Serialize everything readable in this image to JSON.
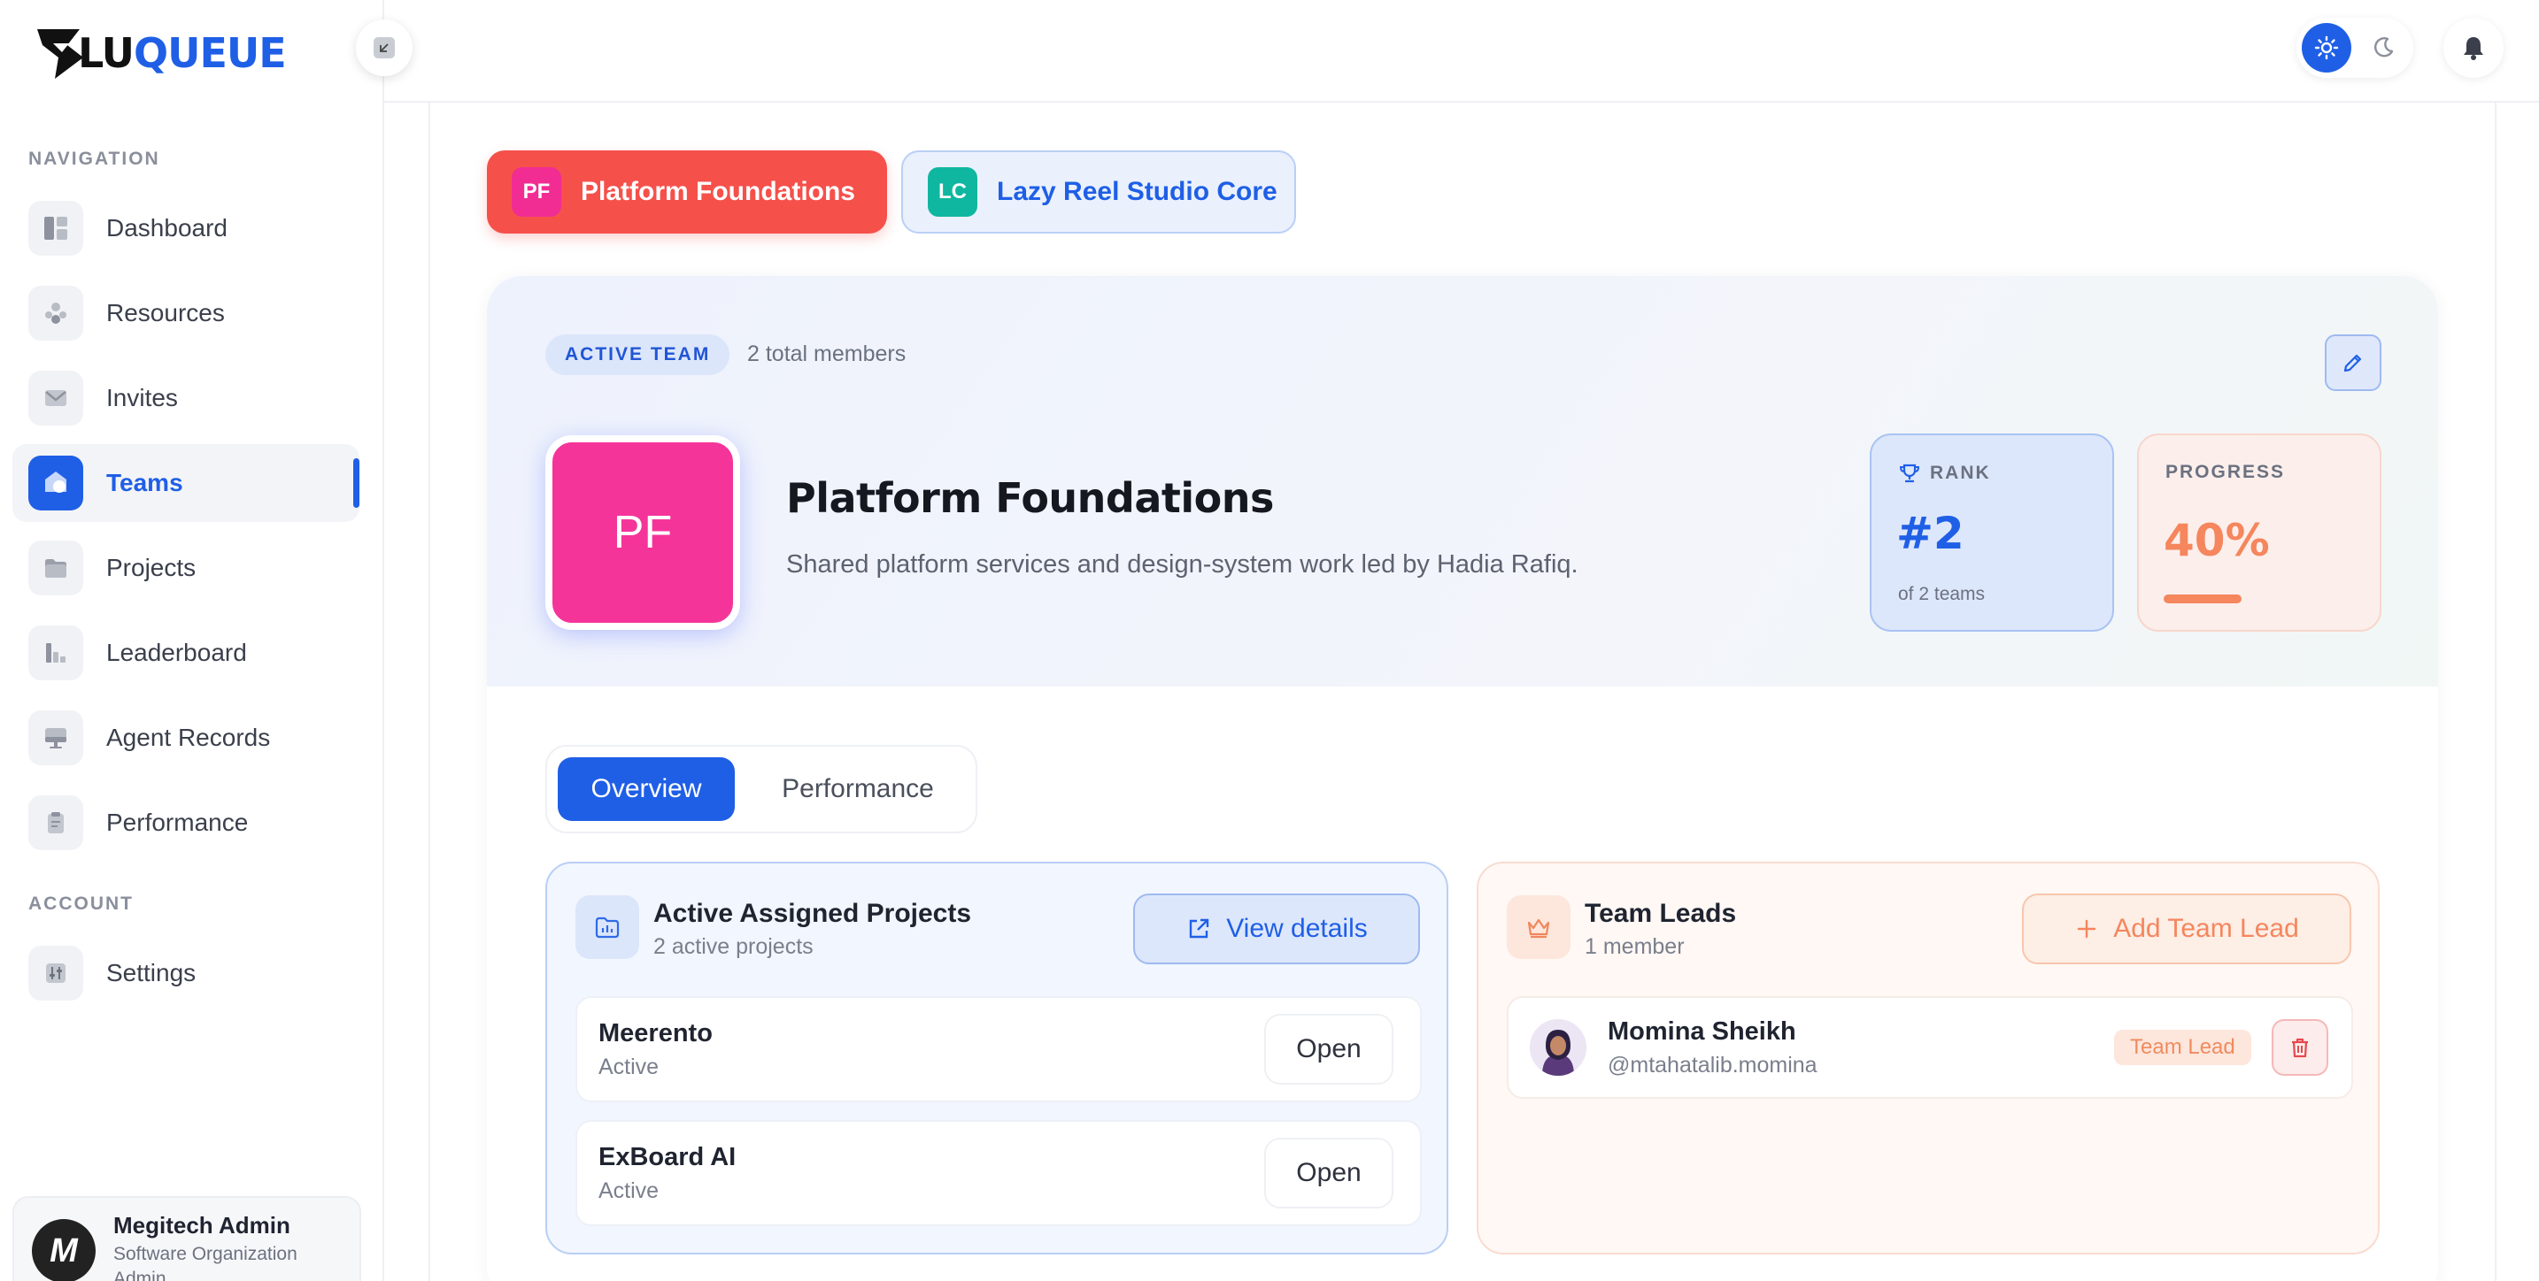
{
  "brand": {
    "logo_prefix": "LU",
    "logo_suffix": "QUEUE",
    "accent": "#1f5fe6"
  },
  "sidebar": {
    "nav_section": "NAVIGATION",
    "account_section": "ACCOUNT",
    "items": [
      {
        "label": "Dashboard",
        "icon": "dashboard-icon"
      },
      {
        "label": "Resources",
        "icon": "resources-icon"
      },
      {
        "label": "Invites",
        "icon": "mail-icon"
      },
      {
        "label": "Teams",
        "icon": "teams-icon",
        "active": true
      },
      {
        "label": "Projects",
        "icon": "folder-icon"
      },
      {
        "label": "Leaderboard",
        "icon": "leaderboard-icon"
      },
      {
        "label": "Agent Records",
        "icon": "monitor-icon"
      },
      {
        "label": "Performance",
        "icon": "clipboard-icon"
      }
    ],
    "account_items": [
      {
        "label": "Settings",
        "icon": "sliders-icon"
      }
    ],
    "user": {
      "initial": "M",
      "name": "Megitech Admin",
      "role": "Software Organization Admin"
    }
  },
  "team_tabs": [
    {
      "initials": "PF",
      "label": "Platform Foundations",
      "selected": true
    },
    {
      "initials": "LC",
      "label": "Lazy Reel Studio Core",
      "selected": false
    }
  ],
  "team": {
    "badge": "ACTIVE TEAM",
    "members": "2 total members",
    "initials": "PF",
    "name": "Platform Foundations",
    "description": "Shared platform services and design-system work led by Hadia Rafiq.",
    "rank": {
      "label": "RANK",
      "value": "#2",
      "sub": "of 2 teams"
    },
    "progress": {
      "label": "PROGRESS",
      "value": "40%",
      "fraction": 0.4
    }
  },
  "view_tabs": {
    "overview": "Overview",
    "performance": "Performance"
  },
  "projects_panel": {
    "title": "Active Assigned Projects",
    "subtitle": "2 active projects",
    "view_button": "View details",
    "open_label": "Open",
    "rows": [
      {
        "name": "Meerento",
        "status": "Active"
      },
      {
        "name": "ExBoard AI",
        "status": "Active"
      }
    ]
  },
  "leads_panel": {
    "title": "Team Leads",
    "subtitle": "1 member",
    "add_button": "Add Team Lead",
    "leads": [
      {
        "name": "Momina Sheikh",
        "handle": "@mtahatalib.momina",
        "tag": "Team Lead"
      }
    ]
  }
}
